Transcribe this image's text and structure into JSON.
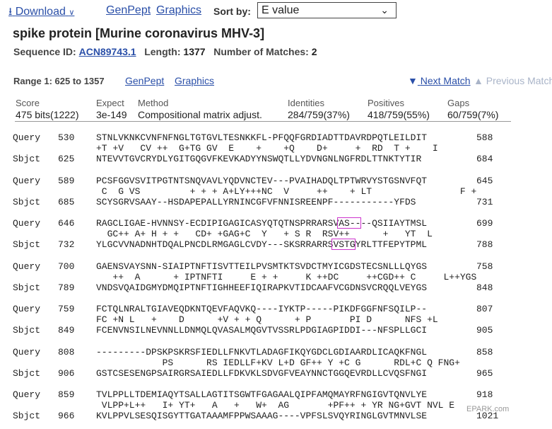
{
  "toolbar": {
    "download_label": "Download",
    "genpept_label": "GenPept",
    "graphics_label": "Graphics",
    "sortby_label": "Sort by:",
    "sort_value": "E value"
  },
  "title": "spike protein [Murine coronavirus MHV-3]",
  "meta": {
    "seqid_label": "Sequence ID:",
    "seqid": "ACN89743.1",
    "length_label": "Length:",
    "length": "1377",
    "matches_label": "Number of Matches:",
    "matches": "2"
  },
  "range": {
    "label": "Range 1: 625 to 1357",
    "genpept": "GenPept",
    "graphics": "Graphics",
    "next": "Next Match",
    "prev": "Previous Match"
  },
  "scores": {
    "headers": [
      "Score",
      "Expect",
      "Method",
      "Identities",
      "Positives",
      "Gaps"
    ],
    "values": [
      "475 bits(1222)",
      "3e-149",
      "Compositional matrix adjust.",
      "284/759(37%)",
      "418/759(55%)",
      "60/759(7%)"
    ]
  },
  "alignment": [
    {
      "q_start": "530",
      "q_seq": "STNLVKNKCVNFNFNGLTGTGVLTESNKKFL-PFQQFGRDIADTTDAVRDPQTLEILDIT",
      "q_end": "588",
      "mid": "+T +V   CV ++  G+TG GV  E    +    +Q    D+     +  RD  T +    I",
      "s_start": "625",
      "s_seq": "NTEVVTGVCRYDLYGITGQGVFKEVKADYYNSWQTLLYDVNGNLNGFRDLTTNKTYTIR",
      "s_end": "684"
    },
    {
      "q_start": "589",
      "q_seq": "PCSFGGVSVITPGTNTSNQVAVLYQDVNCTEV---PVAIHADQLTPTWRVYSTGSNVFQT",
      "q_end": "645",
      "mid": " C  G VS         + + + A+LY+++NC  V     ++    + LT                F +",
      "s_start": "685",
      "s_seq": "SCYSGRVSAAY--HSDAPEPALLYRNINCGFVFNNISREENPF-----------YFDS",
      "s_end": "731"
    },
    {
      "q_start": "646",
      "q_seq": "RAGCLIGAE-HVNNSY-ECDIPIGAGICASYQTQTNSPRRARSVAS----QSIIAYTMSL",
      "q_end": "699",
      "mid": "  GC++ A+ H + +   CD+ +GAG+C  Y   + S R  RSV++      +   YT  L",
      "s_start": "732",
      "s_seq": "YLGCVVNADNHTDQALPNCDLRMGAGLCVDY---SKSRRARRSVSTGYRLTTFEPYTPML",
      "s_end": "788"
    },
    {
      "q_start": "700",
      "q_seq": "GAENSVAYSNN-SIAIPTNFTISVTTEILPVSMTKTSVDCTMYICGDSTECSNLLLQYGS",
      "q_end": "758",
      "mid": "   ++  A      + IPTNFTI     E + +     K ++DC     ++CGD++ C     L++YGS",
      "s_start": "789",
      "s_seq": "VNDSVQAIDGMYDMQIPTNFTIGHHEEFIQIRAPKVTIDCAAFVCGDNSVCRQQLVEYGS",
      "s_end": "848"
    },
    {
      "q_start": "759",
      "q_seq": "FCTQLNRALTGIAVEQDKNTQEVFAQVKQ----IYKTP-----PIKDFGGFNFSQILP--",
      "q_end": "807",
      "mid": "FC +N L   +    D      +V + + Q      + P       PI D      NFS +L",
      "s_start": "849",
      "s_seq": "FCENVNSILNEVNNLLDNMQLQVASALMQGVTVSSRLPDGIAGPIDDI---NFSPLLGCI",
      "s_end": "905"
    },
    {
      "q_start": "808",
      "q_seq": "---------DPSKPSKRSFIEDLLFNKVTLADAGFIKQYGDCLGDIAARDLICAQKFNGL",
      "q_end": "858",
      "mid": "            PS      RS IEDLLF+KV L+D GF++ Y +C G      RDL+C Q FNG+",
      "s_start": "906",
      "s_seq": "GSTCSESENGPSAIRGRSAIEDLLFDKVKLSDVGFVEAYNNCTGGQEVRDLLCVQSFNGI",
      "s_end": "965"
    },
    {
      "q_start": "859",
      "q_seq": "TVLPPLLTDEMIAQYTSALLAGTITSGWTFGAGAALQIPFAMQMAYRFNGIGVTQNVLYE",
      "q_end": "918",
      "mid": " VLPP+L++   I+ YT+   A   +   W+  AG       +PF++ + YR NG+GVT NVL E",
      "s_start": "966",
      "s_seq": "KVLPPVLSESQISGYTTGATAAAMFPPWSAAAG----VPFSLSVQYRINGLGVTMNVLSE",
      "s_end": "1021"
    }
  ],
  "labels": {
    "query": "Query",
    "sbjct": "Sbjct"
  },
  "watermark": "EPARK.com"
}
